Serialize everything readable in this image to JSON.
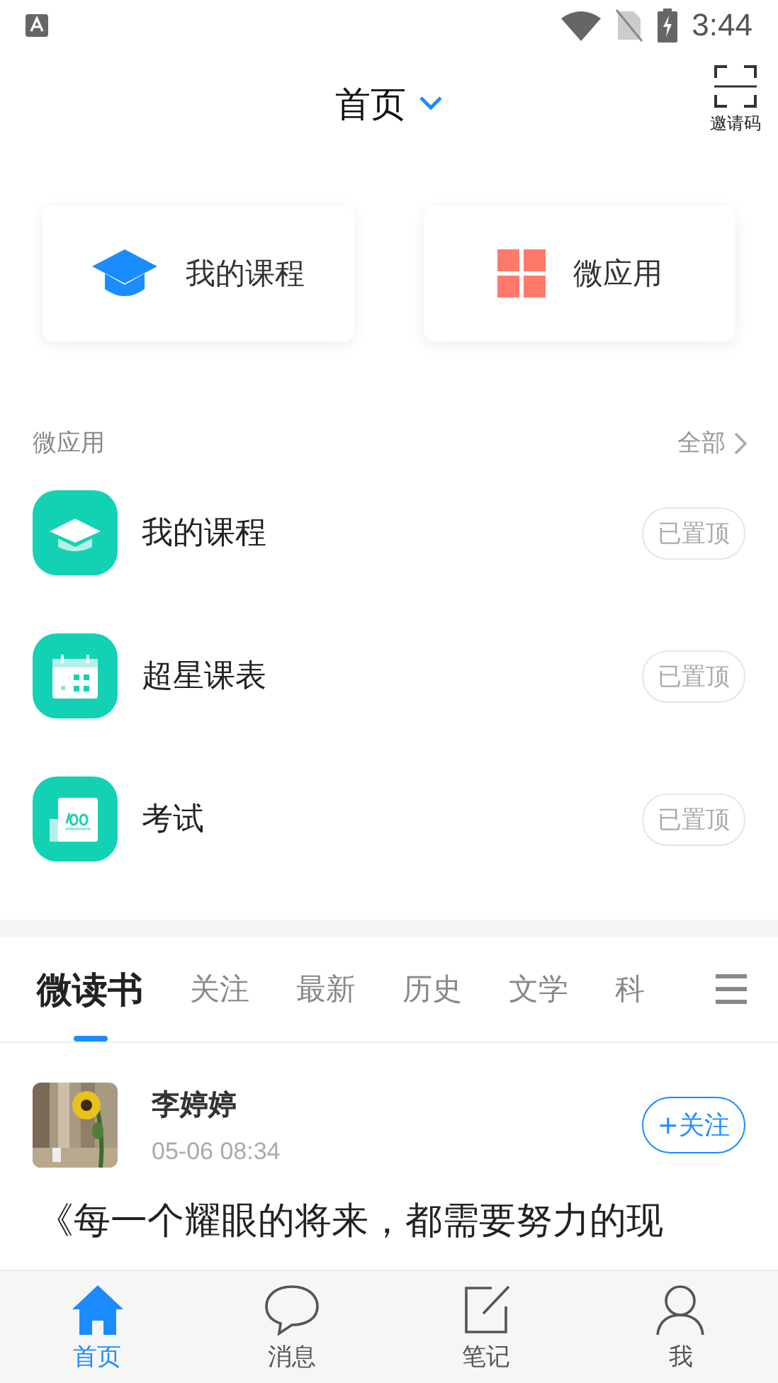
{
  "status_bar": {
    "time": "3:44"
  },
  "header": {
    "title": "首页",
    "invite_label": "邀请码"
  },
  "shortcuts": [
    {
      "label": "我的课程",
      "kind": "course"
    },
    {
      "label": "微应用",
      "kind": "apps"
    }
  ],
  "apps_section": {
    "title": "微应用",
    "more": "全部"
  },
  "apps": [
    {
      "name": "我的课程",
      "kind": "course",
      "badge": "已置顶"
    },
    {
      "name": "超星课表",
      "kind": "calendar",
      "badge": "已置顶"
    },
    {
      "name": "考试",
      "kind": "exam",
      "badge": "已置顶"
    }
  ],
  "feed_tabs": [
    {
      "label": "微读书",
      "selected": true
    },
    {
      "label": "关注",
      "selected": false
    },
    {
      "label": "最新",
      "selected": false
    },
    {
      "label": "历史",
      "selected": false
    },
    {
      "label": "文学",
      "selected": false
    },
    {
      "label": "科",
      "selected": false
    }
  ],
  "post": {
    "author": "李婷婷",
    "time": "05-06 08:34",
    "follow": "+关注",
    "title": "《每一个耀眼的将来，都需要努力的现"
  },
  "nav": [
    {
      "label": "首页",
      "kind": "home",
      "selected": true
    },
    {
      "label": "消息",
      "kind": "message",
      "selected": false
    },
    {
      "label": "笔记",
      "kind": "note",
      "selected": false
    },
    {
      "label": "我",
      "kind": "me",
      "selected": false
    }
  ]
}
